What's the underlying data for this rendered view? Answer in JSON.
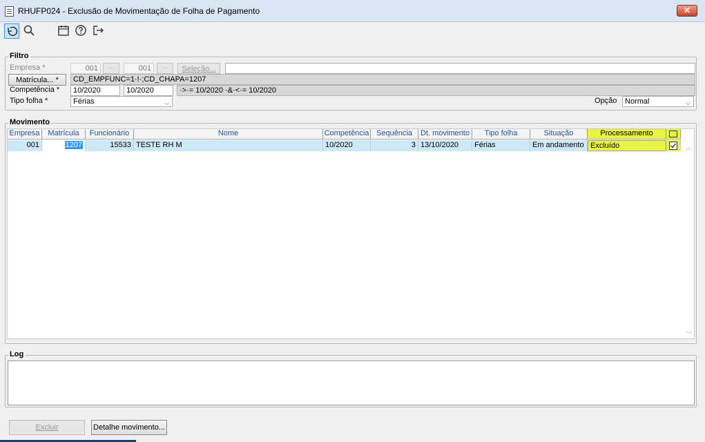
{
  "window": {
    "title": "RHUFP024 - Exclusão de Movimentação de Folha de Pagamento",
    "close_glyph": "✕"
  },
  "toolbar": {
    "icons": [
      "undo-icon",
      "search-icon",
      "calendar-icon",
      "help-icon",
      "exit-icon"
    ]
  },
  "filtro": {
    "title": "Filtro",
    "empresa_label": "Empresa *",
    "empresa_from": "001",
    "empresa_to": "001",
    "selecao_label": "Seleção...",
    "matricula_button": "Matrícula... *",
    "matricula_value": "CD_EMPFUNC=1·!·;CD_CHAPA=1207",
    "competencia_label": "Competência *",
    "competencia_from": "10/2020",
    "competencia_to": "10/2020",
    "competencia_expr": "·>·= 10/2020 ·&·<·= 10/2020",
    "tipo_folha_label": "Tipo folha *",
    "tipo_folha_value": "Férias",
    "opcao_label": "Opção",
    "opcao_value": "Normal"
  },
  "movimento": {
    "title": "Movimento",
    "columns": [
      "Empresa",
      "Matrícula",
      "Funcionário",
      "Nome",
      "Competência",
      "Sequência",
      "Dt. movimento",
      "Tipo folha",
      "Situação",
      "Processamento"
    ],
    "rows": [
      {
        "empresa": "001",
        "matricula": "1207",
        "funcionario": "15533",
        "nome": "TESTE RH M",
        "competencia": "10/2020",
        "sequencia": "3",
        "dt_movimento": "13/10/2020",
        "tipo_folha": "Férias",
        "situacao": "Em andamento",
        "processamento": "Excluído",
        "checked": true
      }
    ],
    "highlight_color": "#e8f542",
    "selected_row_color": "#cde8f6"
  },
  "log": {
    "title": "Log",
    "text": ""
  },
  "footer": {
    "excluir": "Excluir",
    "detalhe": "Detalhe movimento..."
  }
}
